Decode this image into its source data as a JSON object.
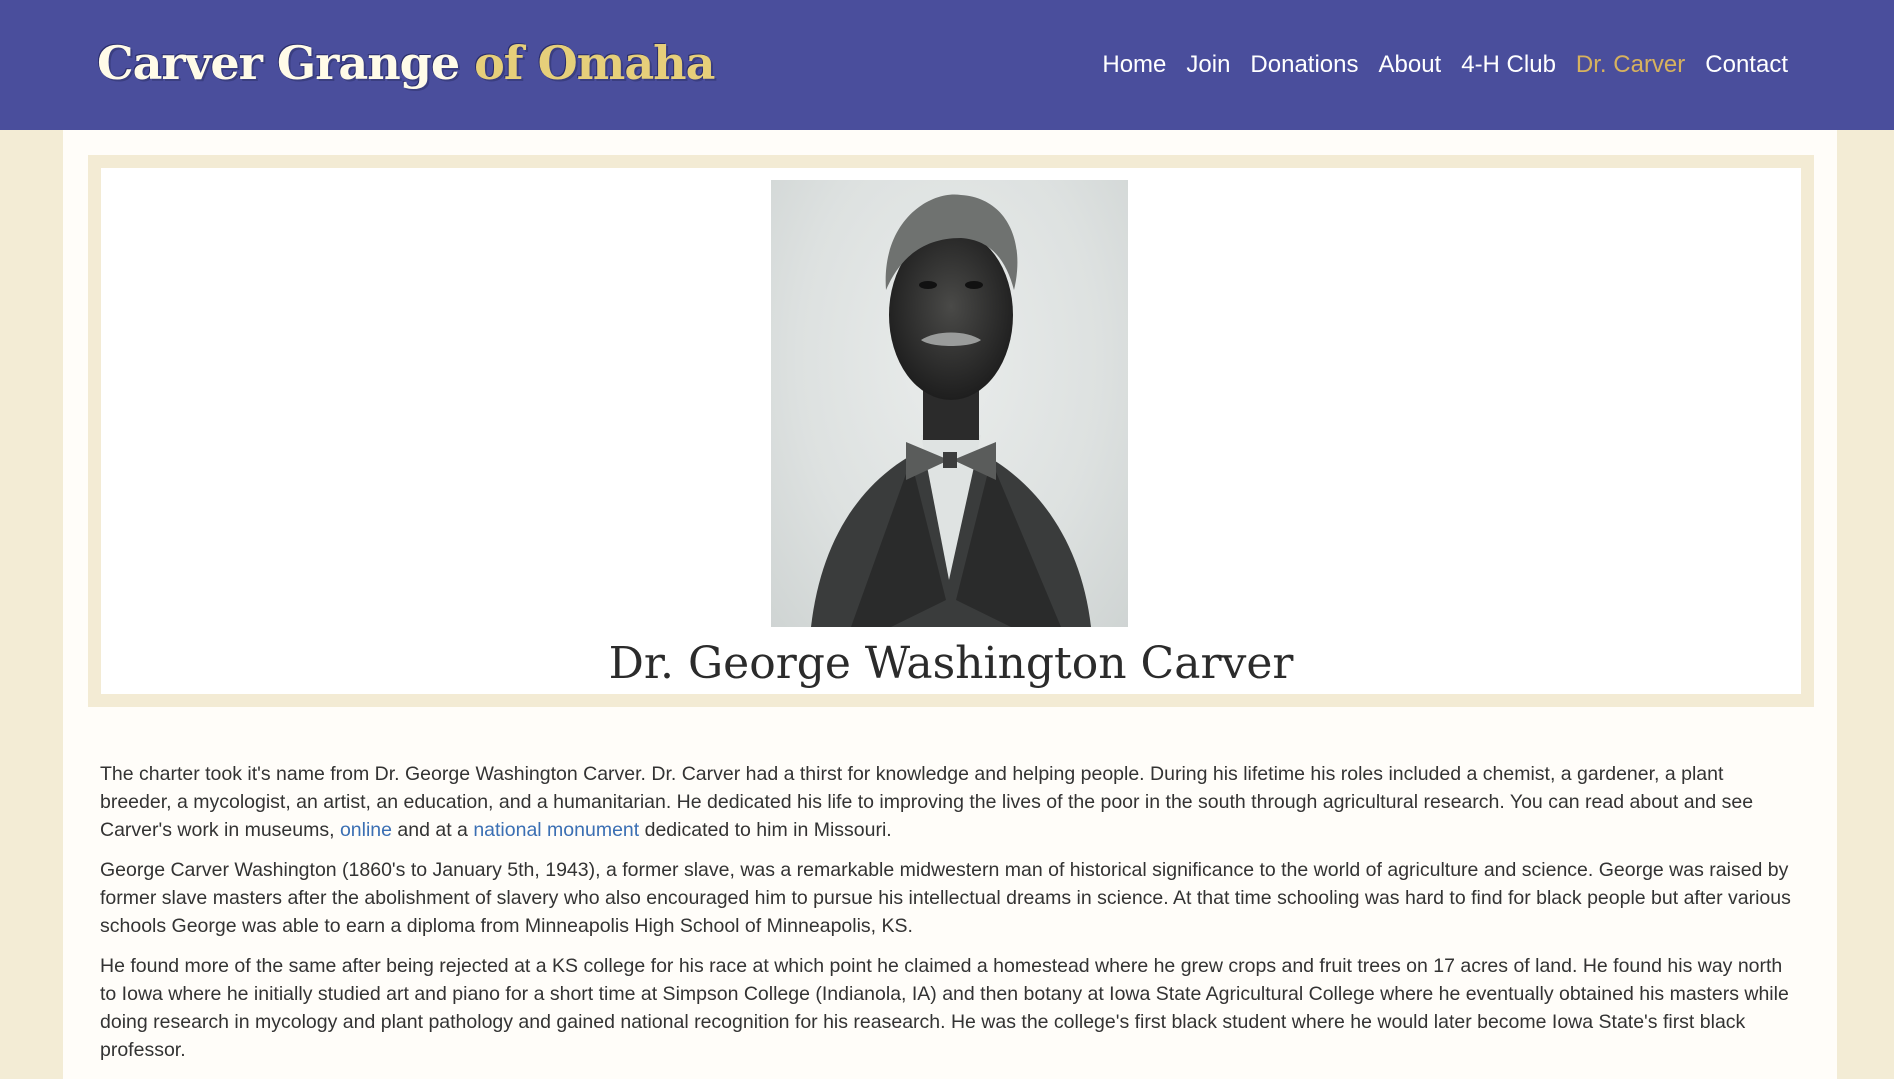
{
  "header": {
    "brand_part1": "Carver Grange",
    "brand_part2": "of Omaha",
    "nav": [
      {
        "label": "Home"
      },
      {
        "label": "Join"
      },
      {
        "label": "Donations"
      },
      {
        "label": "About"
      },
      {
        "label": "4-H Club"
      },
      {
        "label": "Dr. Carver",
        "active": true
      },
      {
        "label": "Contact"
      }
    ]
  },
  "hero": {
    "title": "Dr. George Washington Carver",
    "image_icon": "portrait-photo"
  },
  "content": {
    "p1": {
      "before_link1": "The charter took it's name from Dr. George Washington Carver. Dr. Carver had a thirst for knowledge and helping people. During his lifetime his roles included a chemist, a gardener, a plant breeder, a mycologist, an artist, an education, and a humanitarian. He dedicated his life to improving the lives of the poor in the south through agricultural research. You can read about and see Carver's work in museums, ",
      "link1": "online",
      "between_links": " and at a ",
      "link2": "national monument",
      "after_link2": " dedicated to him in Missouri."
    },
    "p2": "George Carver Washington (1860's to January 5th, 1943), a former slave, was a remarkable midwestern man of historical significance to the world of agriculture and science. George was raised by former slave masters after the abolishment of slavery who also encouraged him to pursue his intellectual dreams in science. At that time schooling was hard to find for black people but after various schools George was able to earn a diploma from Minneapolis High School of Minneapolis, KS.",
    "p3": "He found more of the same after being rejected at a KS college for his race at which point he claimed a homestead where he grew crops and fruit trees on 17 acres of land. He found his way north to Iowa where he initially studied art and piano for a short time at Simpson College (Indianola, IA) and then botany at Iowa State Agricultural College where he eventually obtained his masters while doing research in mycology and plant pathology and gained national recognition for his reasearch. He was the college's first black student where he would later become Iowa State's first black professor."
  },
  "colors": {
    "header_bg": "#4a4e9c",
    "nav_active": "#d7b25e",
    "link": "#3b6fb3",
    "page_bg": "#f3ecd5"
  }
}
